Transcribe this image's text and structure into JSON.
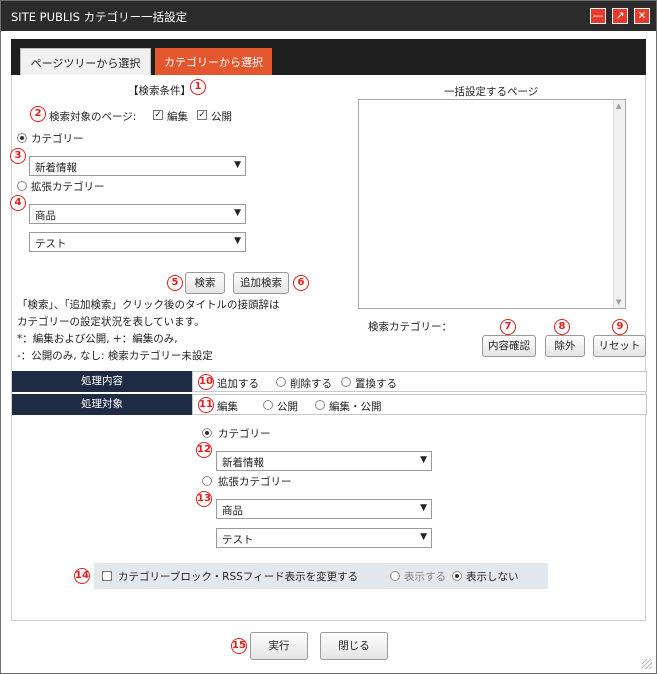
{
  "window": {
    "title": "SITE PUBLIS カテゴリー一括設定"
  },
  "tabs": [
    {
      "label": "ページツリーから選択"
    },
    {
      "label": "カテゴリーから選択"
    }
  ],
  "search": {
    "header": "【検索条件】",
    "target_label": "検索対象のページ:",
    "edit_label": "編集",
    "publish_label": "公開",
    "category_label": "カテゴリー",
    "category_value": "新着情報",
    "ext_category_label": "拡張カテゴリー",
    "ext_value1": "商品",
    "ext_value2": "テスト",
    "search_button": "検索",
    "add_search_button": "追加検索",
    "note": [
      "「検索」、「追加検索」クリック後のタイトルの接頭辞は",
      "カテゴリーの設定状況を表しています。",
      "*：編集および公開, +：編集のみ,",
      "-：公開のみ, なし: 検索カテゴリー未設定"
    ]
  },
  "right": {
    "header": "一括設定するページ",
    "search_category_label": "検索カテゴリー：",
    "confirm_button": "内容確認",
    "exclude_button": "除外",
    "reset_button": "リセット"
  },
  "process": {
    "label": "処理内容",
    "options": [
      "追加する",
      "削除する",
      "置換する"
    ],
    "target_label": "処理対象",
    "target_options": [
      "編集",
      "公開",
      "編集・公開"
    ]
  },
  "bottom": {
    "category_label": "カテゴリー",
    "category_value": "新着情報",
    "ext_category_label": "拡張カテゴリー",
    "ext_value1": "商品",
    "ext_value2": "テスト"
  },
  "rss": {
    "label": "カテゴリーブロック・RSSフィード表示を変更する",
    "show": "表示する",
    "hide": "表示しない"
  },
  "footer": {
    "run": "実行",
    "close": "閉じる"
  },
  "markers": [
    "1",
    "2",
    "3",
    "4",
    "5",
    "6",
    "7",
    "8",
    "9",
    "10",
    "11",
    "12",
    "13",
    "14",
    "15"
  ]
}
